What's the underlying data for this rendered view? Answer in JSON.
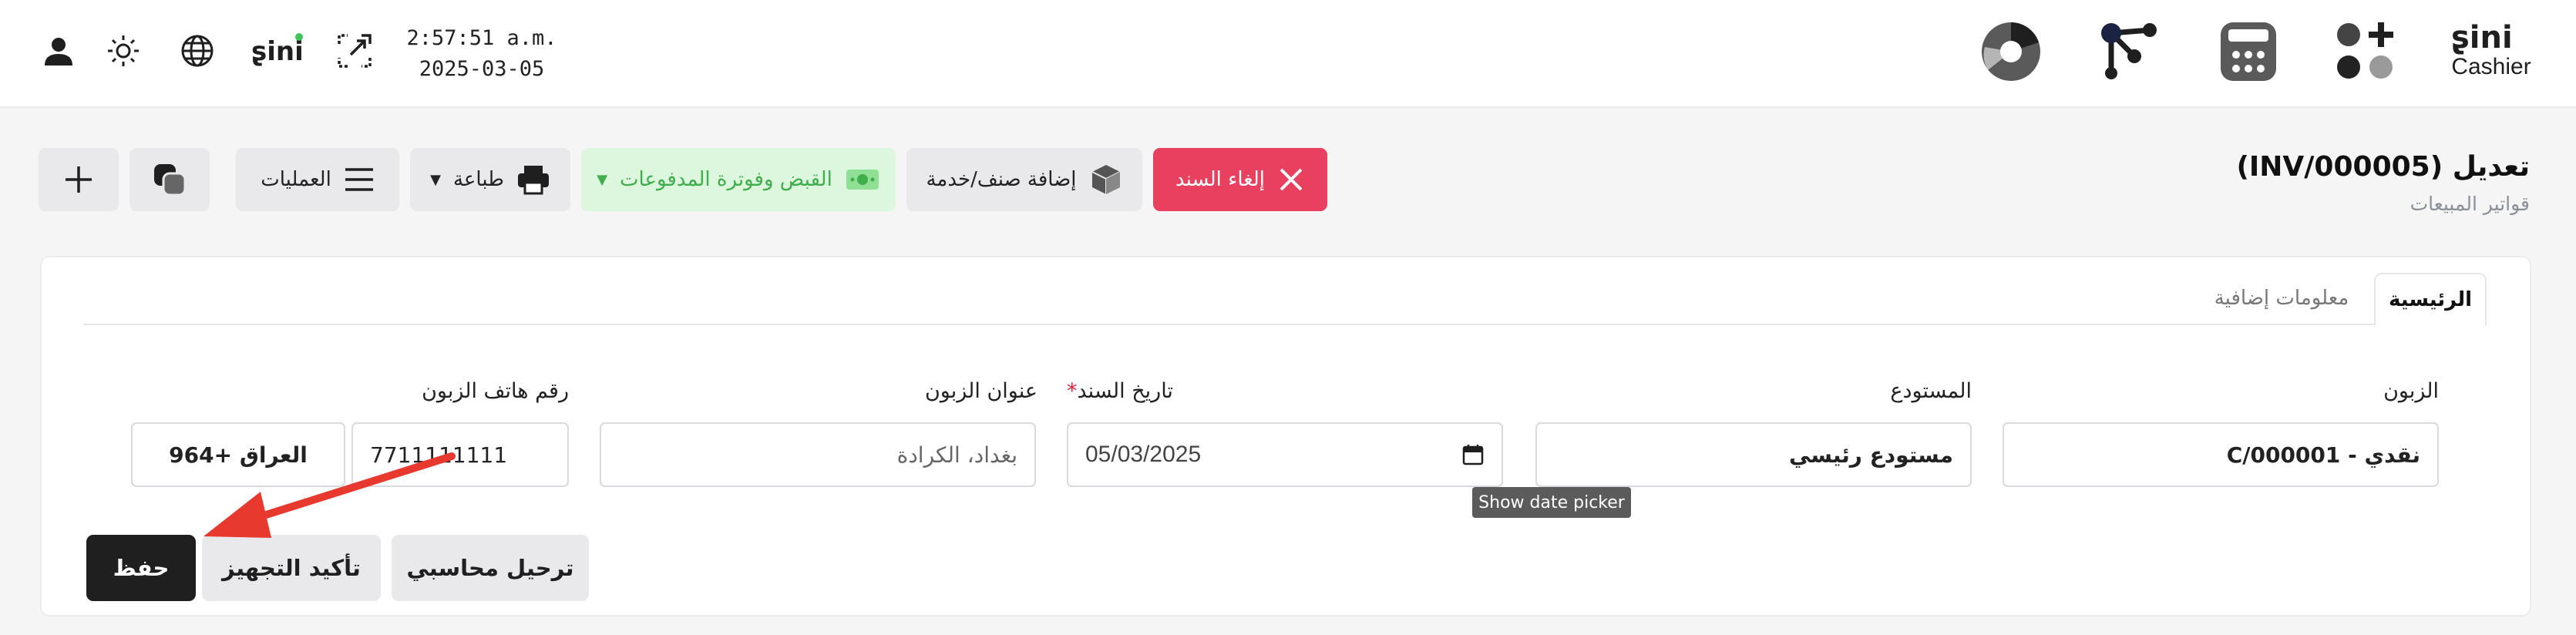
{
  "topbar": {
    "time": "2:57:51 a.m.",
    "date": "2025-03-05",
    "brand_name": "Cashier",
    "app_icons": [
      "pie-chart-icon",
      "share-nodes-icon",
      "calculator-icon",
      "apps-add-icon"
    ],
    "left_icons": [
      "user-icon",
      "sun-icon",
      "globe-icon",
      "sini-chat-logo",
      "expand-icon"
    ]
  },
  "header": {
    "title": "تعديل (INV/000005)",
    "subtitle": "قواتير المبيعات"
  },
  "toolbar": {
    "cancel_label": "إلغاء السند",
    "add_item_label": "إضافة صنف/خدمة",
    "payment_label": "القبض وفوترة المدفوعات",
    "print_label": "طباعة",
    "operations_label": "العمليات"
  },
  "tabs": {
    "main": "الرئيسية",
    "extra": "معلومات إضافية"
  },
  "form": {
    "customer_label": "الزبون",
    "customer_value": "نقدي - C/000001",
    "warehouse_label": "المستودع",
    "warehouse_value": "مستودع رئيسي",
    "date_label": "تاريخ السند",
    "date_required": "*",
    "date_value": "05/03/2025",
    "address_label": "عنوان الزبون",
    "address_value": "بغداد، الكرادة",
    "phone_label": "رقم هاتف الزبون",
    "phone_value": "7711111111",
    "country_code": "العراق +964"
  },
  "tooltip": "Show date picker",
  "actions": {
    "post_label": "ترحيل محاسبي",
    "confirm_label": "تأكيد التجهيز",
    "save_label": "حفظ"
  },
  "colors": {
    "danger": "#e8405e",
    "success_bg": "#dcf7de",
    "success_text": "#3fae4b",
    "primary_dark": "#1f1f1f",
    "arrow": "#e8392f"
  }
}
